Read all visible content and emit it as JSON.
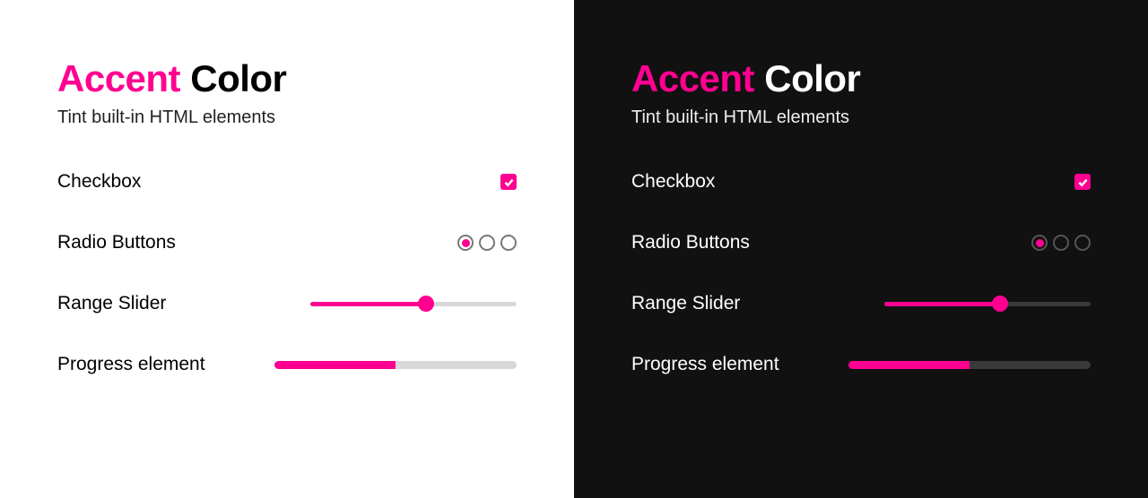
{
  "accent_color": "#ff0090",
  "title_accent": "Accent",
  "title_rest": "Color",
  "subtitle": "Tint built-in HTML elements",
  "rows": {
    "checkbox": {
      "label": "Checkbox",
      "checked": true
    },
    "radio": {
      "label": "Radio Buttons",
      "options": [
        {
          "selected": true
        },
        {
          "selected": false
        },
        {
          "selected": false
        }
      ]
    },
    "slider": {
      "label": "Range Slider",
      "value": 56,
      "min": 0,
      "max": 100
    },
    "progress": {
      "label": "Progress element",
      "value": 50,
      "max": 100
    }
  }
}
